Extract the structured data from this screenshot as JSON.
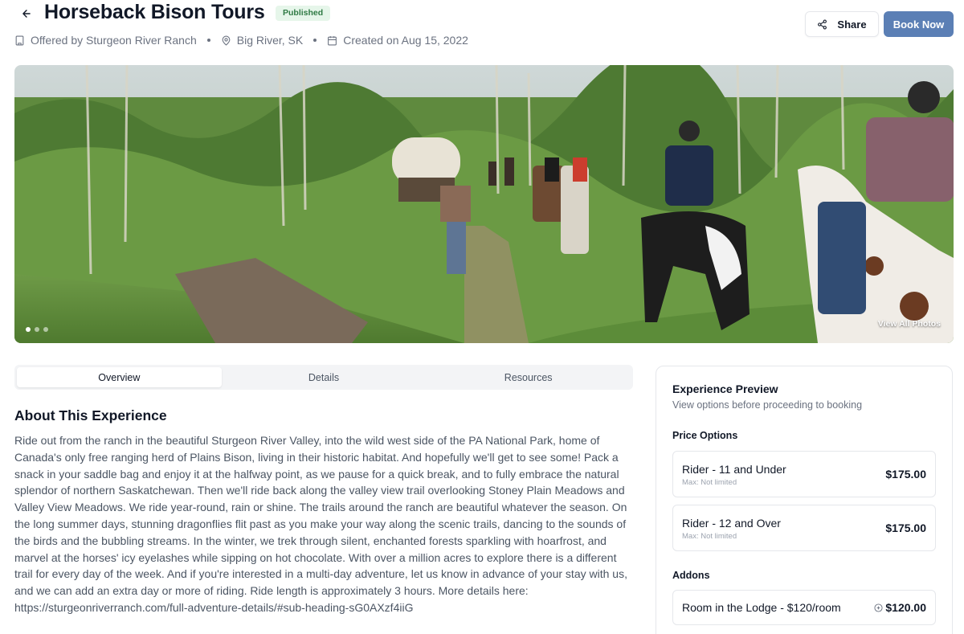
{
  "header": {
    "title": "Horseback Bison Tours",
    "status_badge": "Published",
    "offered_by": "Offered by Sturgeon River Ranch",
    "location": "Big River, SK",
    "created": "Created on Aug 15, 2022",
    "share_label": "Share",
    "book_label": "Book Now"
  },
  "hero": {
    "view_all_label": "View All Photos",
    "slide_count": 3,
    "active_slide": 1
  },
  "tabs": [
    {
      "label": "Overview",
      "active": true
    },
    {
      "label": "Details",
      "active": false
    },
    {
      "label": "Resources",
      "active": false
    }
  ],
  "about": {
    "heading": "About This Experience",
    "body": "Ride out from the ranch in the beautiful Sturgeon River Valley, into the wild west side of the PA National Park, home of Canada's only free ranging herd of Plains Bison, living in their historic habitat. And hopefully we'll get to see some! Pack a snack in your saddle bag and enjoy it at the halfway point, as we pause for a quick break, and to fully embrace the natural splendor of northern Saskatchewan. Then we'll ride back along the valley view trail overlooking Stoney Plain Meadows and Valley View Meadows. We ride year-round, rain or shine. The trails around the ranch are beautiful whatever the season. On the long summer days, stunning dragonflies flit past as you make your way along the scenic trails, dancing to the sounds of the birds and the bubbling streams. In the winter, we trek through silent, enchanted forests sparkling with hoarfrost, and marvel at the horses' icy eyelashes while sipping on hot chocolate. With over a million acres to explore there is a different trail for every day of the week. And if you're interested in a multi-day adventure, let us know in advance of your stay with us, and we can add an extra day or more of riding. Ride length is approximately 3 hours. More details here: https://sturgeonriverranch.com/full-adventure-details/#sub-heading-sG0AXzf4iiG"
  },
  "preview": {
    "title": "Experience Preview",
    "subtitle": "View options before proceeding to booking",
    "price_options_label": "Price Options",
    "price_options": [
      {
        "name": "Rider - 11 and Under",
        "max": "Max: Not limited",
        "price": "$175.00"
      },
      {
        "name": "Rider - 12 and Over",
        "max": "Max: Not limited",
        "price": "$175.00"
      }
    ],
    "addons_label": "Addons",
    "addons": [
      {
        "name": "Room in the Lodge - $120/room",
        "price": "$120.00"
      }
    ]
  },
  "colors": {
    "primary": "#5b7fb5",
    "badge_bg": "#e6f6ea",
    "badge_text": "#2f7a44"
  },
  "icons": [
    "arrow-left-icon",
    "building-icon",
    "map-pin-icon",
    "calendar-icon",
    "share-icon",
    "plus-circle-icon"
  ]
}
